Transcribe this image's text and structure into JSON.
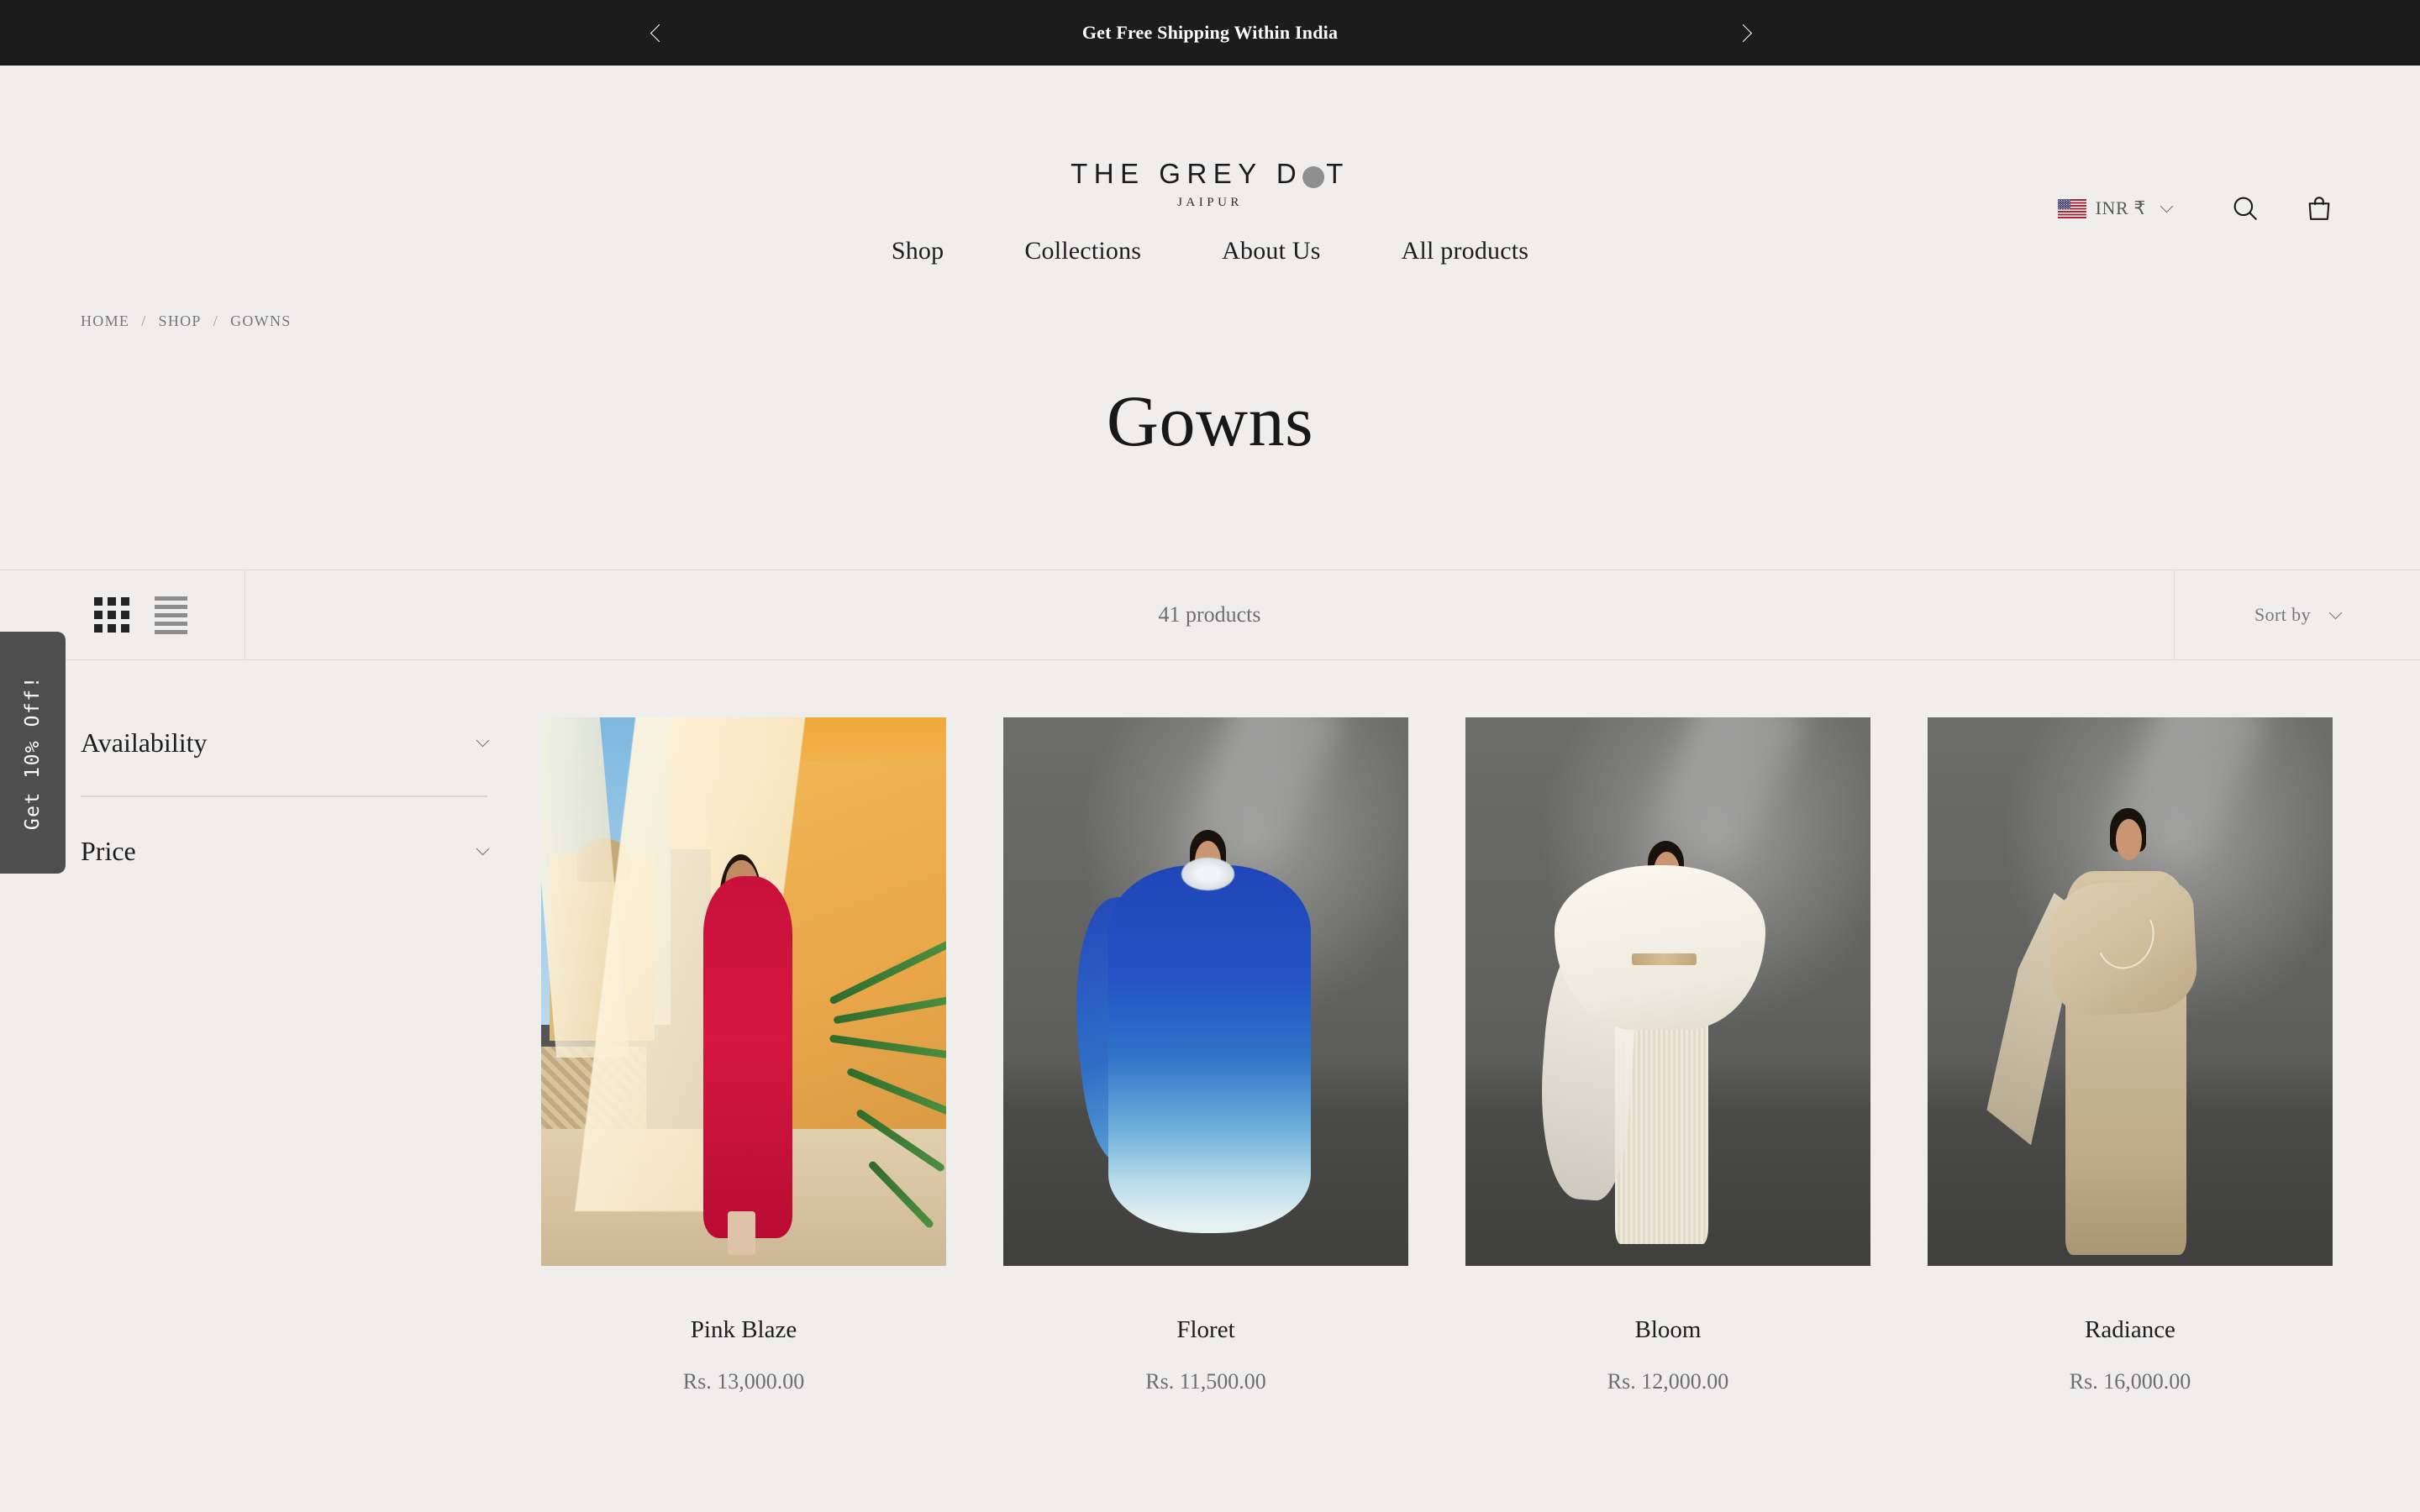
{
  "announcement": {
    "text": "Get Free Shipping Within India",
    "prev_icon": "chevron-left-icon",
    "next_icon": "chevron-right-icon"
  },
  "header": {
    "logo": {
      "line1_before": "THE GREY D",
      "dot_icon": "grey-dot-logo-mark",
      "line1_after": "T",
      "line2": "JAIPUR"
    },
    "currency": {
      "flag_icon": "us-flag-icon",
      "label": "INR ₹",
      "chevron_icon": "chevron-down-icon"
    },
    "search_icon": "search-icon",
    "cart_icon": "shopping-bag-icon"
  },
  "nav": {
    "items": [
      {
        "label": "Shop"
      },
      {
        "label": "Collections"
      },
      {
        "label": "About Us"
      },
      {
        "label": "All products"
      }
    ]
  },
  "breadcrumb": {
    "items": [
      {
        "label": "HOME"
      },
      {
        "label": "SHOP"
      },
      {
        "label": "GOWNS"
      }
    ],
    "separator": "/"
  },
  "page": {
    "title": "Gowns"
  },
  "toolbar": {
    "grid_view_icon": "grid-view-icon",
    "list_view_icon": "list-view-icon",
    "product_count": "41 products",
    "sort_label": "Sort by",
    "sort_chevron_icon": "chevron-down-icon"
  },
  "filters": {
    "groups": [
      {
        "label": "Availability",
        "chevron_icon": "chevron-down-icon"
      },
      {
        "label": "Price",
        "chevron_icon": "chevron-down-icon"
      }
    ]
  },
  "promo": {
    "label": "Get 10% Off!"
  },
  "products": [
    {
      "title": "Pink Blaze",
      "price": "Rs. 13,000.00"
    },
    {
      "title": "Floret",
      "price": "Rs. 11,500.00"
    },
    {
      "title": "Bloom",
      "price": "Rs. 12,000.00"
    },
    {
      "title": "Radiance",
      "price": "Rs. 16,000.00"
    }
  ],
  "colors": {
    "page_background": "#efeeec",
    "announcement_background": "#1c1c1c",
    "text_primary": "#1d1d1d",
    "text_muted": "#6e6e72",
    "border": "#dcdad8",
    "promo_background": "#4e4e4e",
    "logo_dot": "#8f8f8f"
  }
}
